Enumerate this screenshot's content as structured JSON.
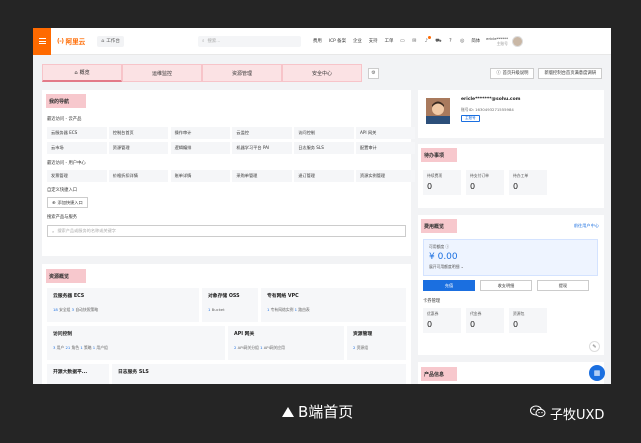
{
  "topbar": {
    "logo_mark": "(-)",
    "logo_text": "阿里云",
    "workbench": "工作台",
    "search_placeholder": "搜索...",
    "links": [
      "费用",
      "ICP 备案",
      "企业",
      "支持",
      "工单"
    ],
    "notification_count": "2",
    "language": "简体",
    "user_name": "ericle******",
    "user_role": "主账号"
  },
  "tabs": [
    {
      "label": "概览",
      "icon": "home-icon"
    },
    {
      "label": "运维监控"
    },
    {
      "label": "资源管理"
    },
    {
      "label": "安全中心"
    }
  ],
  "header_buttons": {
    "upgrade": "首页升级说明",
    "survey": "新版控制台首页满意度调研"
  },
  "navigation": {
    "title": "我的导航",
    "recent_products_label": "最近访问 - 云产品",
    "recent_products": [
      "云服务器 ECS",
      "控制台首页",
      "操作审计",
      "云监控",
      "访问控制",
      "API 网关",
      "云市场",
      "资源管理",
      "逻辑编排",
      "机器学习平台 PAI",
      "日志服务 SLS",
      "配置审计"
    ],
    "recent_user_label": "最近访问 - 用户中心",
    "recent_user": [
      "发票管理",
      "价格折扣详情",
      "账单详情",
      "采购单管理",
      "退订管理",
      "资源实例管理"
    ],
    "custom_label": "自定义快捷入口",
    "add_entry": "添加快捷入口",
    "search_label": "搜索产品与服务",
    "search_placeholder": "搜索产品或服务的名称或关键字"
  },
  "resources": {
    "title": "资源概览",
    "cells": [
      {
        "title": "云服务器 ECS",
        "meta": [
          {
            "n": "18",
            "t": "安全组"
          },
          {
            "n": "3",
            "t": "自动快照策略"
          }
        ]
      },
      {
        "title": "对象存储 OSS",
        "meta": [
          {
            "n": "1",
            "t": "Bucket"
          }
        ]
      },
      {
        "title": "专有网络 VPC",
        "meta": [
          {
            "n": "1",
            "t": "专有网络实例"
          },
          {
            "n": "1",
            "t": "路由表"
          }
        ]
      },
      {
        "title": "访问控制",
        "meta": [
          {
            "n": "3",
            "t": "用户"
          },
          {
            "n": "21",
            "t": "角色"
          },
          {
            "n": "1",
            "t": "策略"
          },
          {
            "n": "1",
            "t": "用户组"
          }
        ]
      },
      {
        "title": "API 网关",
        "meta": [
          {
            "n": "2",
            "t": "API网关分组"
          },
          {
            "n": "1",
            "t": "API网关应用"
          }
        ]
      },
      {
        "title": "资源管理",
        "meta": [
          {
            "n": "2",
            "t": "资源组"
          }
        ]
      },
      {
        "title": "开源大数据平...",
        "meta": []
      },
      {
        "title": "日志服务 SLS",
        "meta": []
      }
    ]
  },
  "account": {
    "email": "ericle*******@sohu.com",
    "id": "账号ID: 1630493271555984",
    "tag": "主账号"
  },
  "todo": {
    "title": "待办事项",
    "items": [
      {
        "label": "待续费项",
        "value": "0"
      },
      {
        "label": "待支付订单",
        "value": "0"
      },
      {
        "label": "待办工单",
        "value": "0"
      }
    ]
  },
  "billing": {
    "title": "费用概览",
    "link": "前往用户中心",
    "available_label": "可用额度",
    "amount": "¥ 0.00",
    "expand": "展开可用额度明细",
    "buttons": [
      "充值",
      "收支明细",
      "提现"
    ],
    "coupon_label": "卡券管理",
    "coupons": [
      {
        "label": "优惠券",
        "value": "0"
      },
      {
        "label": "代金券",
        "value": "0"
      },
      {
        "label": "资源包",
        "value": "0"
      }
    ]
  },
  "product_info": {
    "title": "产品信息"
  },
  "caption": {
    "text": "B端首页",
    "brand": "子牧UXD"
  },
  "colors": {
    "accent": "#ff6a00",
    "primary": "#1b6fe0",
    "highlight": "#f7c8cd"
  }
}
